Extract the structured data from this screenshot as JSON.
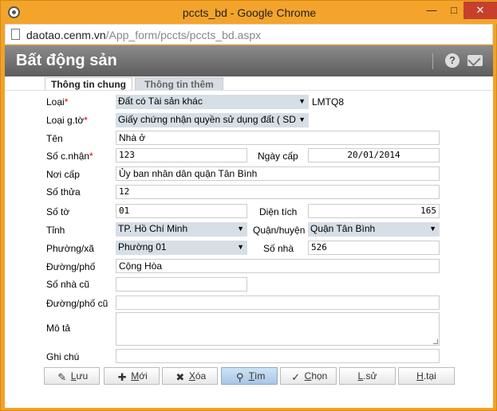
{
  "window": {
    "title": "pccts_bd - Google Chrome"
  },
  "address": {
    "host": "daotao.cenm.vn",
    "path": "/App_form/pccts/pccts_bd.aspx"
  },
  "header": {
    "title": "Bất động sản"
  },
  "tabs": [
    {
      "label": "Thông tin chung",
      "active": true
    },
    {
      "label": "Thông tin thêm",
      "active": false
    }
  ],
  "form": {
    "loai": {
      "label": "Loại",
      "value": "Đất có Tài sản khác",
      "code": "LMTQ8"
    },
    "loai_gto": {
      "label": "Loại g.tờ",
      "value": "Giấy chứng nhận quyền sử dụng đất ( SD"
    },
    "ten": {
      "label": "Tên",
      "value": "Nhà ở"
    },
    "so_cnhan": {
      "label": "Số c.nhận",
      "value": "123"
    },
    "ngay_cap": {
      "label": "Ngày cấp",
      "value": "20/01/2014"
    },
    "noi_cap": {
      "label": "Nơi cấp",
      "value": "Ủy ban nhân dân quận Tân Bình"
    },
    "so_thua": {
      "label": "Số thửa",
      "value": "12"
    },
    "so_to": {
      "label": "Số tờ",
      "value": "01"
    },
    "dien_tich": {
      "label": "Diện tích",
      "value": "165"
    },
    "tinh": {
      "label": "Tỉnh",
      "value": "TP. Hồ Chí Minh"
    },
    "quan_huyen": {
      "label": "Quận/huyện",
      "value": "Quận Tân Bình"
    },
    "phuong_xa": {
      "label": "Phường/xã",
      "value": "Phường 01"
    },
    "so_nha": {
      "label": "Số nhà",
      "value": "526"
    },
    "duong_pho": {
      "label": "Đường/phố",
      "value": "Cộng Hòa"
    },
    "so_nha_cu": {
      "label": "Số nhà cũ",
      "value": ""
    },
    "duong_pho_cu": {
      "label": "Đường/phố cũ",
      "value": ""
    },
    "mo_ta": {
      "label": "Mô tả",
      "value": ""
    },
    "ghi_chu": {
      "label": "Ghi chú",
      "value": ""
    }
  },
  "buttons": {
    "luu": {
      "key": "L",
      "rest": "ưu"
    },
    "moi": {
      "key": "M",
      "rest": "ới"
    },
    "xoa": {
      "key": "X",
      "rest": "óa"
    },
    "tim": {
      "key": "T",
      "rest": "ìm"
    },
    "chon": {
      "key": "C",
      "rest": "họn"
    },
    "lsu": {
      "key": "L",
      "rest": ".sử"
    },
    "htai": {
      "key": "H",
      "rest": ".tại"
    }
  },
  "colors": {
    "titlebar": "#f4a42b",
    "close": "#c7402b",
    "header": "#6e6e6e",
    "select_bg": "#d6dee6",
    "required": "#dd0000"
  }
}
